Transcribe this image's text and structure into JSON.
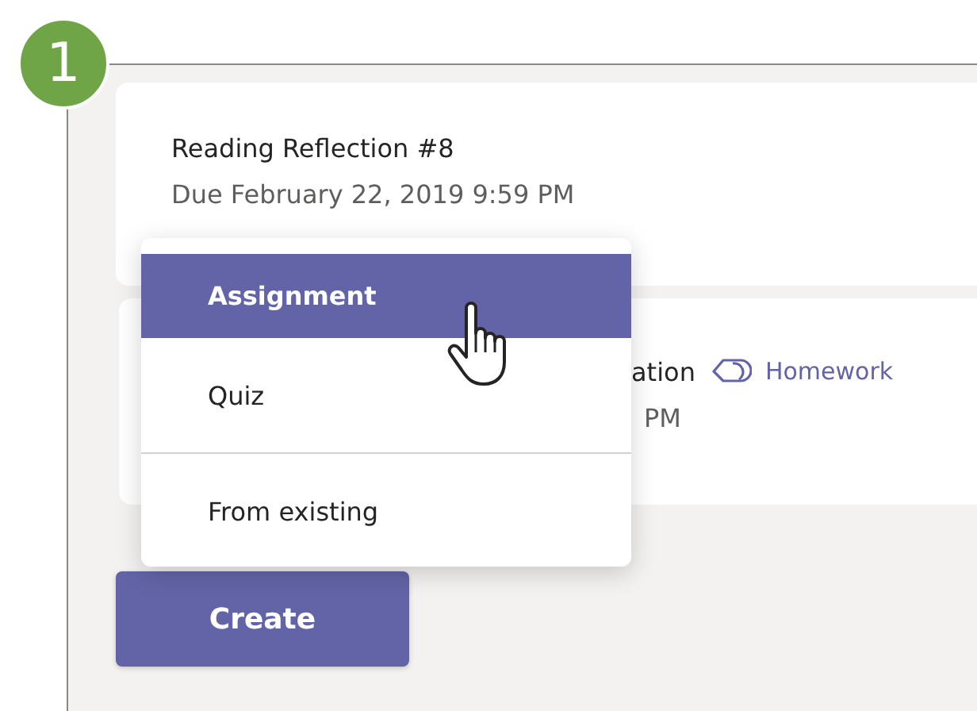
{
  "step_badge": "1",
  "cards": [
    {
      "title": "Reading Reflection #8",
      "due": "Due February 22, 2019 9:59 PM"
    },
    {
      "title": "ation",
      "due": "PM",
      "tag": "Homework"
    }
  ],
  "menu": {
    "items": [
      {
        "label": "Assignment",
        "selected": true,
        "divider_before": false
      },
      {
        "label": "Quiz",
        "selected": false,
        "divider_before": false
      },
      {
        "label": "From existing",
        "selected": false,
        "divider_before": true
      }
    ]
  },
  "create_button": "Create"
}
